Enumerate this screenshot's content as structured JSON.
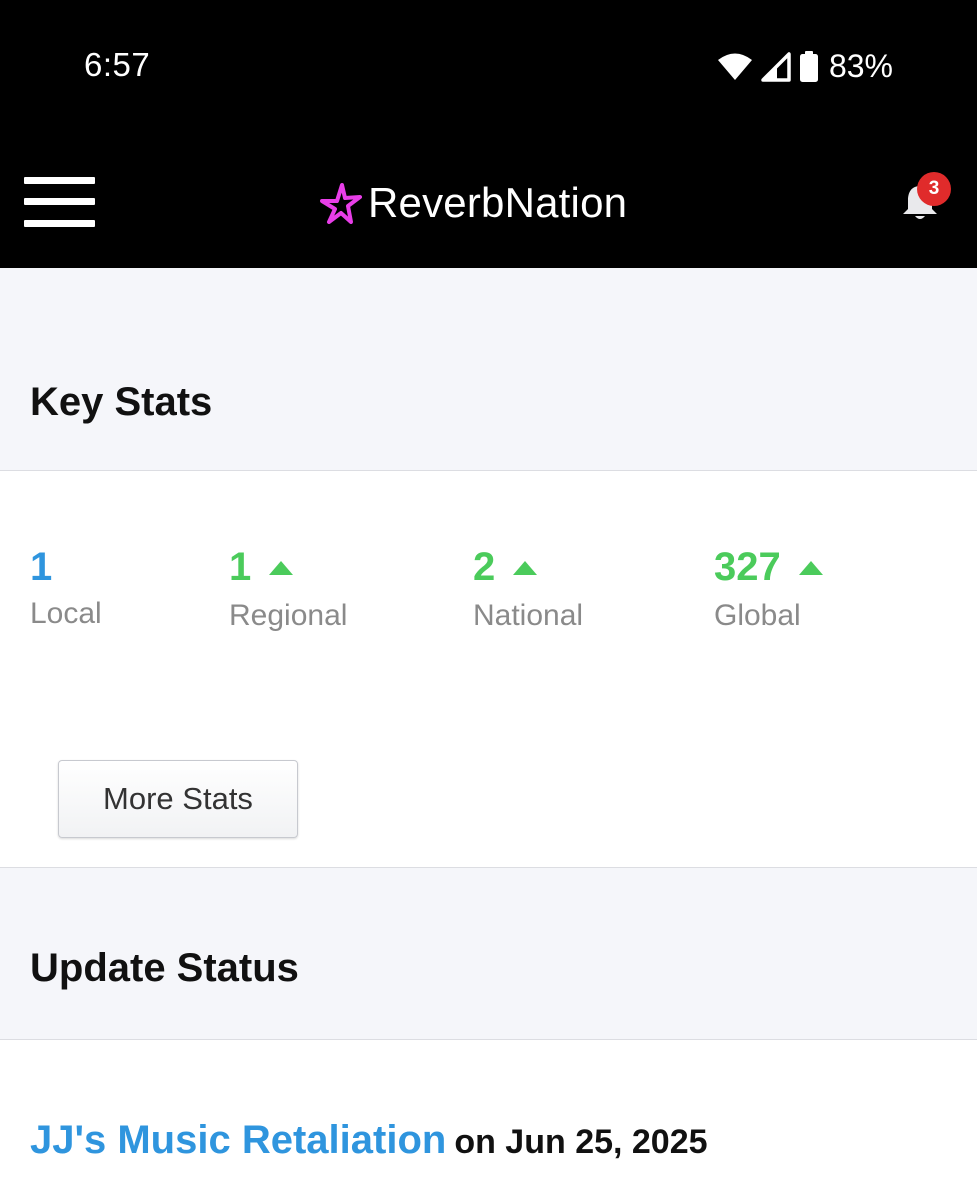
{
  "status_bar": {
    "time": "6:57",
    "battery": "83%",
    "icons": [
      "wifi-icon",
      "signal-icon",
      "battery-icon"
    ]
  },
  "header": {
    "logo_text": "ReverbNation",
    "notification_count": "3",
    "brand_color": "#e83ee8"
  },
  "key_stats": {
    "title": "Key Stats",
    "stats": [
      {
        "value": "1",
        "label": "Local",
        "trend": "none",
        "color": "#2f95de"
      },
      {
        "value": "1",
        "label": "Regional",
        "trend": "up",
        "color": "#4bcb5b"
      },
      {
        "value": "2",
        "label": "National",
        "trend": "up",
        "color": "#4bcb5b"
      },
      {
        "value": "327",
        "label": "Global",
        "trend": "up",
        "color": "#4bcb5b"
      }
    ],
    "more_button": "More Stats"
  },
  "update_status": {
    "title": "Update Status",
    "link_text": "JJ's Music Retaliation",
    "date_text": "on Jun 25, 2025"
  }
}
